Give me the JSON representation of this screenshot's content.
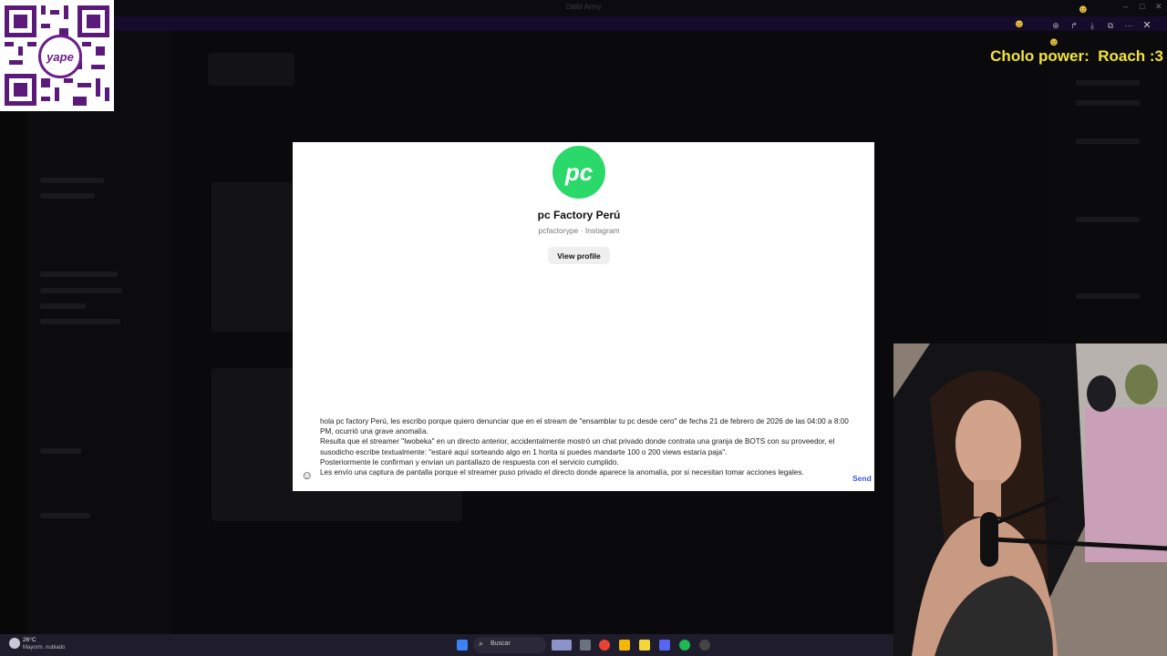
{
  "background_app": {
    "window_title": "Dibbi Army",
    "window_controls": [
      "–",
      "□",
      "✕"
    ]
  },
  "qr_code": {
    "brand": "yape"
  },
  "overlay": {
    "label": "Cholo power:  Roach :3"
  },
  "viewer_toolbar": {
    "icons": [
      "zoom-in-icon",
      "share-icon",
      "download-icon",
      "open-external-icon",
      "more-icon"
    ],
    "close": "✕"
  },
  "instagram_panel": {
    "avatar_text": "pc",
    "profile_name": "pc Factory Perú",
    "profile_subtitle": "pcfactorype · Instagram",
    "view_profile_label": "View profile",
    "message_lines": [
      "hola pc factory Perú, les escribo porque quiero denunciar que en el stream de \"ensamblar tu pc desde cero\" de fecha 21 de febrero de 2026 de las 04:00 a 8:00 PM, ocurrió una grave anomalía.",
      "Resulta que el streamer \"Iwobeka\" en un directo anterior, accidentalmente mostró un chat privado donde contrata una granja de BOTS con su proveedor, el susodicho escribe textualmente: \"estaré aquí sorteando algo en 1 horita si puedes mandarte 100 o 200 views estaría paja\".",
      "Posteriormente le confirman y envían un pantallazo de respuesta con el servicio cumplido.",
      "Les envío una captura de pantalla porque el streamer puso privado el directo donde aparece la anomalía, por si necesitan tomar acciones legales."
    ],
    "send_label": "Send"
  },
  "taskbar": {
    "weather_temp": "26°C",
    "weather_desc": "Mayorm. nublado",
    "search_label": "Buscar",
    "search_icon": "⌕",
    "apps": [
      {
        "name": "windows-start-icon",
        "color": "#3b82f6"
      },
      {
        "name": "file-explorer-icon",
        "color": "#6b7280"
      },
      {
        "name": "chrome-icon",
        "color": "#ea4335"
      },
      {
        "name": "folder-icon",
        "color": "#f5b800"
      },
      {
        "name": "sticky-notes-icon",
        "color": "#f2d63a"
      },
      {
        "name": "discord-icon",
        "color": "#5865f2"
      },
      {
        "name": "spotify-icon",
        "color": "#1db954"
      },
      {
        "name": "obs-icon",
        "color": "#444"
      }
    ]
  }
}
